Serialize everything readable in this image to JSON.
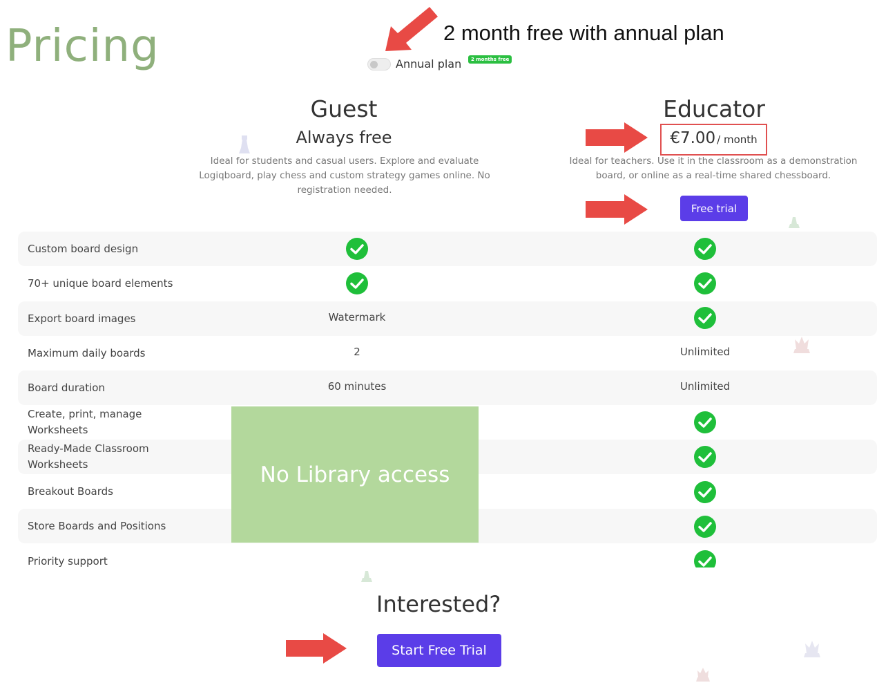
{
  "page": {
    "title": "Pricing",
    "annotation": "2 month free with annual plan"
  },
  "toggle": {
    "label": "Annual plan",
    "badge": "2 months free",
    "state": "off"
  },
  "plans": {
    "guest": {
      "name": "Guest",
      "subtitle": "Always free",
      "desc_lines": [
        "Ideal for students and casual users. Explore and evaluate",
        "Logiqboard, play chess and custom strategy games online. No",
        "registration needed."
      ]
    },
    "educator": {
      "name": "Educator",
      "price": "€7.00",
      "period": "/ month",
      "desc_lines": [
        "Ideal for teachers. Use it in the classroom as a demonstration",
        "board, or online as a real-time shared chessboard."
      ],
      "button_label": "Free trial"
    }
  },
  "features": [
    {
      "label": "Custom board design",
      "guest": "check",
      "educator": "check"
    },
    {
      "label": "70+ unique board elements",
      "guest": "check",
      "educator": "check"
    },
    {
      "label": "Export board images",
      "guest": "Watermark",
      "educator": "check"
    },
    {
      "label": "Maximum daily boards",
      "guest": "2",
      "educator": "Unlimited"
    },
    {
      "label": "Board duration",
      "guest": "60 minutes",
      "educator": "Unlimited"
    },
    {
      "label_lines": [
        "Create, print, manage",
        "Worksheets"
      ],
      "guest": "",
      "educator": "check"
    },
    {
      "label_lines": [
        "Ready-Made Classroom",
        "Worksheets"
      ],
      "guest": "",
      "educator": "check"
    },
    {
      "label": "Breakout Boards",
      "guest": "",
      "educator": "check"
    },
    {
      "label": "Store Boards and Positions",
      "guest": "",
      "educator": "check"
    },
    {
      "label": "Priority support",
      "guest": "",
      "educator": "check"
    }
  ],
  "overlay": {
    "text": "No Library access"
  },
  "cta": {
    "heading": "Interested?",
    "button_label": "Start Free Trial"
  },
  "colors": {
    "accent": "#5b3de8",
    "title_green": "#8fb07c",
    "overlay_green": "#b3d89c",
    "check_green": "#1fbf3a",
    "arrow_red": "#e84a45",
    "badge_green": "#2bbf41"
  }
}
